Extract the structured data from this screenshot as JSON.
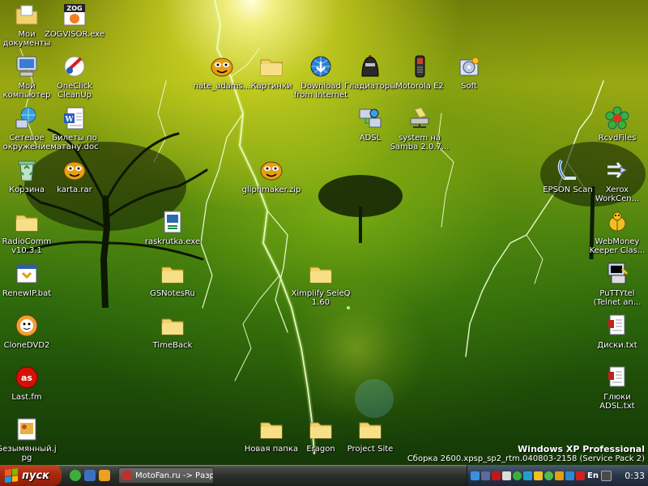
{
  "desktop": {
    "icons": {
      "my_documents": "Мои документы",
      "zogvisor": "ZOGVISOR.exe",
      "zog_glyph": "ZOG",
      "my_computer": "Мой компьютер",
      "oneclick": "OneClick CleanUp",
      "network": "Сетевое окружение",
      "tickets": "Билеты по матану.doc",
      "recycle": "Корзина",
      "karta": "karta.rar",
      "radiocomm": "RadioComm v10.3.1",
      "renewip": "RenewIP.bat",
      "clonedvd": "CloneDVD2",
      "lastfm": "Last.fm",
      "untitled": "Безымянный.jpg",
      "nate": "nate_adams...",
      "pictures": "Картинки",
      "download_internet": "Download from Internet",
      "gladiators": "Гладиаторы",
      "motorola": "Motorola E2",
      "soft": "Soft",
      "adsl": "ADSL",
      "samba": "system на Samba 2.0.7...",
      "gliphmaker": "gliphmaker.zip",
      "raskrutka": "raskrutka.exe",
      "gsnotes": "GSNotesRu",
      "ximplify": "Ximplify SeleQ 1.60",
      "timeback": "TimeBack",
      "new_folder": "Новая папка",
      "eragon": "Eragon",
      "project_site": "Project Site",
      "rcvdfiles": "RcvdFiles",
      "epson": "EPSON Scan",
      "xerox": "Xerox WorkCen...",
      "webmoney": "WebMoney Keeper Clas...",
      "putty": "PuTTYtel (Telnet an...",
      "disks": "Диски.txt",
      "glitches": "Глюки ADSL.txt"
    },
    "brand_line1": "Windows XP Professional",
    "brand_line2": "Сборка 2600.xpsp_sp2_rtm.040803-2158 (Service Pack 2)"
  },
  "taskbar": {
    "start_label": "пуск",
    "active_task": "MotoFan.ru -> Разра...",
    "lang": "En",
    "clock": "0:33"
  },
  "colors": {
    "folder": "#f2d36b",
    "start": "#a82a10",
    "tray": "#2a3648"
  }
}
